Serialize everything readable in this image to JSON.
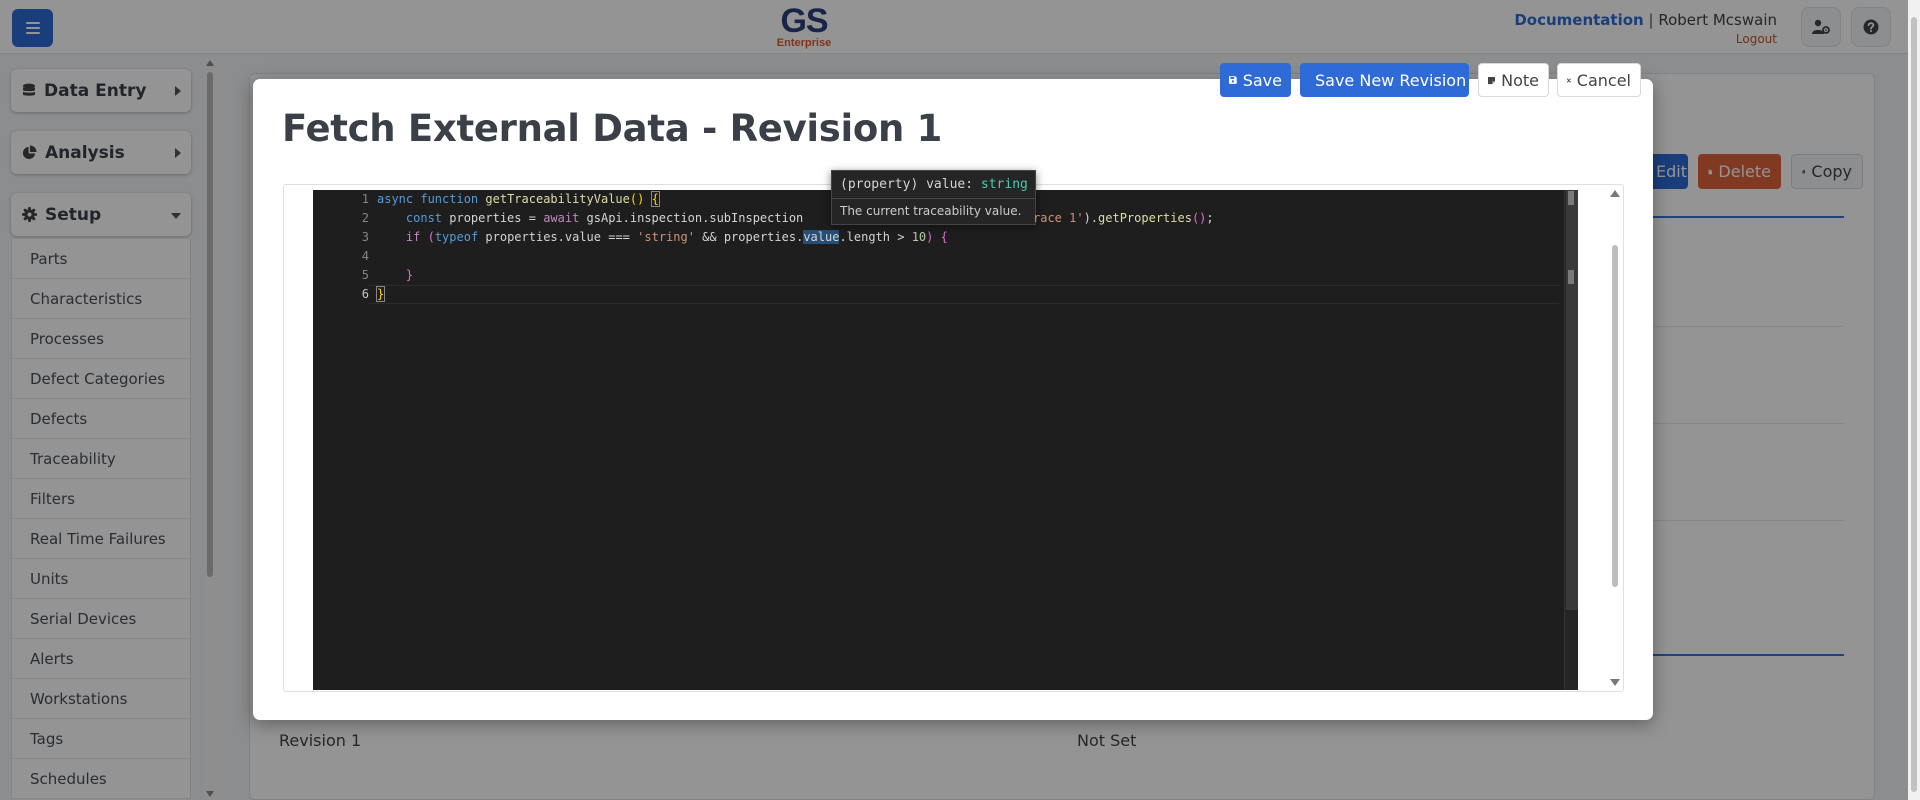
{
  "header": {
    "logo_main": "GS",
    "logo_sub": "Enterprise",
    "documentation_label": "Documentation",
    "separator": "|",
    "user_name": "Robert Mcswain",
    "logout_label": "Logout"
  },
  "sidebar": {
    "groups": [
      {
        "label": "Data Entry",
        "icon": "database-icon",
        "state": "collapsed"
      },
      {
        "label": "Analysis",
        "icon": "pie-chart-icon",
        "state": "collapsed"
      },
      {
        "label": "Setup",
        "icon": "gear-icon",
        "state": "expanded"
      }
    ],
    "setup_items": [
      "Parts",
      "Characteristics",
      "Processes",
      "Defect Categories",
      "Defects",
      "Traceability",
      "Filters",
      "Real Time Failures",
      "Units",
      "Serial Devices",
      "Alerts",
      "Workstations",
      "Tags",
      "Schedules"
    ]
  },
  "background": {
    "edit_label": "Edit",
    "delete_label": "Delete",
    "copy_label": "Copy",
    "revision_text": "Revision 1",
    "value_text": "Not Set"
  },
  "modal": {
    "title": "Fetch External Data - Revision 1",
    "buttons": {
      "save": "Save",
      "save_new_revision": "Save New Revision",
      "note": "Note",
      "cancel": "Cancel"
    }
  },
  "editor": {
    "line_numbers": [
      "1",
      "2",
      "3",
      "4",
      "5",
      "6"
    ],
    "active_line": "6",
    "tooltip": {
      "signature_prefix": "(property) value:",
      "signature_type": "string",
      "doc": "The current traceability value."
    },
    "colors": {
      "background": "#1e1e1e",
      "keyword": "#569cd6",
      "control_keyword": "#c586c0",
      "function": "#dcdcaa",
      "string": "#ce9178",
      "number": "#b5cea8"
    }
  },
  "theme": {
    "primary": "#2e6bd6",
    "danger": "#e0623a",
    "brand_dark": "#2a3f7d",
    "brand_accent": "#e05a2b"
  }
}
